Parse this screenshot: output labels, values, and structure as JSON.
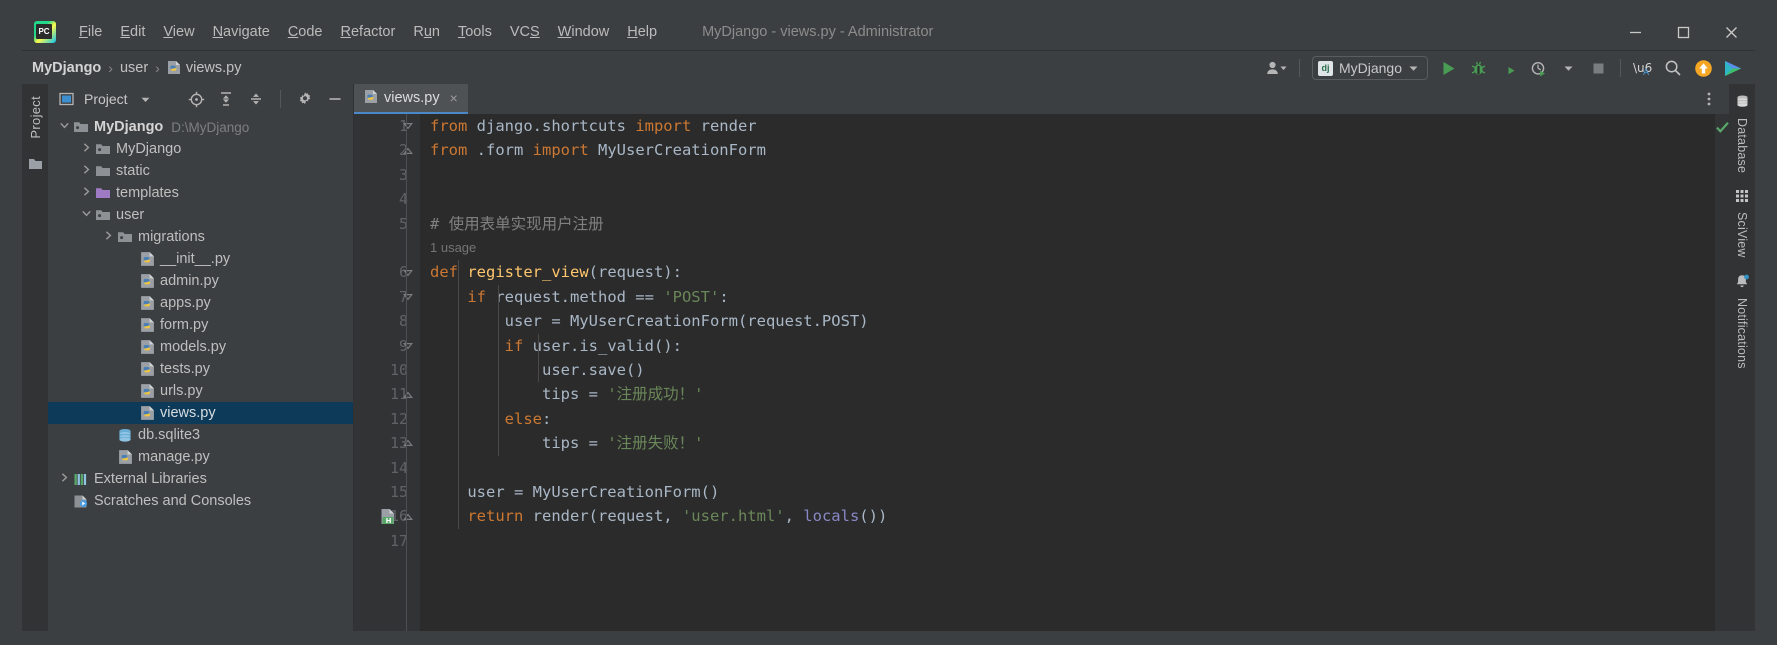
{
  "window": {
    "title": "MyDjango - views.py - Administrator",
    "minimize_label": "minimize-window",
    "maximize_label": "maximize-window",
    "close_label": "close-window"
  },
  "menu": [
    {
      "label": "File",
      "mnemonic": "F"
    },
    {
      "label": "Edit",
      "mnemonic": "E"
    },
    {
      "label": "View",
      "mnemonic": "V"
    },
    {
      "label": "Navigate",
      "mnemonic": "N"
    },
    {
      "label": "Code",
      "mnemonic": "C"
    },
    {
      "label": "Refactor",
      "mnemonic": "R"
    },
    {
      "label": "Run",
      "mnemonic": "u"
    },
    {
      "label": "Tools",
      "mnemonic": "T"
    },
    {
      "label": "VCS",
      "mnemonic": "S"
    },
    {
      "label": "Window",
      "mnemonic": "W"
    },
    {
      "label": "Help",
      "mnemonic": "H"
    }
  ],
  "breadcrumb": {
    "items": [
      "MyDjango",
      "user",
      "views.py"
    ],
    "separator": "›"
  },
  "toolbar": {
    "account_icon": "user-account-icon",
    "run_config": {
      "label": "MyDjango",
      "icon_text": "dj"
    },
    "run_icon": "run-icon",
    "debug_icon": "debug-icon",
    "run_coverage_icon": "run-with-coverage-icon",
    "profile_icon": "profile-icon",
    "stop_icon": "stop-icon",
    "translate_icon": "translate-icon",
    "search_icon": "search-everywhere-icon",
    "update_icon": "update-project-icon",
    "plugin_icon": "plugin-icon"
  },
  "project_panel": {
    "title": "Project",
    "stripe_label": "Project",
    "select_opened_file_icon": "select-opened-file-icon",
    "expand_all_icon": "expand-all-icon",
    "collapse_all_icon": "collapse-all-icon",
    "settings_icon": "gear-icon",
    "hide_icon": "hide-panel-icon",
    "tree": [
      {
        "label": "MyDjango",
        "detail": "D:\\MyDjango",
        "indent": 0,
        "arrow": "down",
        "icon": "project-folder",
        "bold": true,
        "selected": false
      },
      {
        "label": "MyDjango",
        "detail": "",
        "indent": 1,
        "arrow": "right",
        "icon": "module-folder",
        "bold": false,
        "selected": false
      },
      {
        "label": "static",
        "detail": "",
        "indent": 1,
        "arrow": "right",
        "icon": "folder",
        "bold": false,
        "selected": false
      },
      {
        "label": "templates",
        "detail": "",
        "indent": 1,
        "arrow": "right",
        "icon": "templates-folder",
        "bold": false,
        "selected": false
      },
      {
        "label": "user",
        "detail": "",
        "indent": 1,
        "arrow": "down",
        "icon": "module-folder",
        "bold": false,
        "selected": false
      },
      {
        "label": "migrations",
        "detail": "",
        "indent": 2,
        "arrow": "right",
        "icon": "module-folder",
        "bold": false,
        "selected": false
      },
      {
        "label": "__init__.py",
        "detail": "",
        "indent": 3,
        "arrow": "none",
        "icon": "python-file",
        "bold": false,
        "selected": false
      },
      {
        "label": "admin.py",
        "detail": "",
        "indent": 3,
        "arrow": "none",
        "icon": "python-file",
        "bold": false,
        "selected": false
      },
      {
        "label": "apps.py",
        "detail": "",
        "indent": 3,
        "arrow": "none",
        "icon": "python-file",
        "bold": false,
        "selected": false
      },
      {
        "label": "form.py",
        "detail": "",
        "indent": 3,
        "arrow": "none",
        "icon": "python-file",
        "bold": false,
        "selected": false
      },
      {
        "label": "models.py",
        "detail": "",
        "indent": 3,
        "arrow": "none",
        "icon": "python-file",
        "bold": false,
        "selected": false
      },
      {
        "label": "tests.py",
        "detail": "",
        "indent": 3,
        "arrow": "none",
        "icon": "python-file",
        "bold": false,
        "selected": false
      },
      {
        "label": "urls.py",
        "detail": "",
        "indent": 3,
        "arrow": "none",
        "icon": "python-file",
        "bold": false,
        "selected": false
      },
      {
        "label": "views.py",
        "detail": "",
        "indent": 3,
        "arrow": "none",
        "icon": "python-file",
        "bold": false,
        "selected": true
      },
      {
        "label": "db.sqlite3",
        "detail": "",
        "indent": 2,
        "arrow": "none",
        "icon": "database-file",
        "bold": false,
        "selected": false
      },
      {
        "label": "manage.py",
        "detail": "",
        "indent": 2,
        "arrow": "none",
        "icon": "python-file",
        "bold": false,
        "selected": false
      },
      {
        "label": "External Libraries",
        "detail": "",
        "indent": 0,
        "arrow": "right",
        "icon": "libraries",
        "bold": false,
        "selected": false
      },
      {
        "label": "Scratches and Consoles",
        "detail": "",
        "indent": 0,
        "arrow": "none",
        "icon": "scratches",
        "bold": false,
        "selected": false
      }
    ]
  },
  "editor": {
    "tab": {
      "label": "views.py",
      "icon": "python-file",
      "close": "×"
    },
    "options_icon": "editor-options-icon",
    "inspection_status": "ok-checkmark",
    "first_line": 1,
    "last_line": 17,
    "lines": [
      {
        "n": 1,
        "fold": "down",
        "tokens": [
          [
            "kw",
            "from"
          ],
          [
            "txt",
            " django.shortcuts "
          ],
          [
            "kw",
            "import"
          ],
          [
            "txt",
            " render"
          ]
        ]
      },
      {
        "n": 2,
        "fold": "end",
        "tokens": [
          [
            "kw",
            "from"
          ],
          [
            "txt",
            " .form "
          ],
          [
            "kw",
            "import"
          ],
          [
            "txt",
            " MyUserCreationForm"
          ]
        ]
      },
      {
        "n": 3,
        "fold": "none",
        "tokens": []
      },
      {
        "n": 4,
        "fold": "none",
        "tokens": []
      },
      {
        "n": 5,
        "fold": "none",
        "tokens": [
          [
            "cmt",
            "# 使用表单实现用户注册"
          ]
        ]
      },
      {
        "n": 6,
        "fold": "down",
        "hint": "1 usage",
        "tokens": [
          [
            "kw",
            "def"
          ],
          [
            "fn",
            " register_view"
          ],
          [
            "txt",
            "(request):"
          ]
        ]
      },
      {
        "n": 7,
        "fold": "down",
        "tokens": [
          [
            "txt",
            "    "
          ],
          [
            "kw",
            "if"
          ],
          [
            "txt",
            " request.method == "
          ],
          [
            "str",
            "'POST'"
          ],
          [
            "txt",
            ":"
          ]
        ]
      },
      {
        "n": 8,
        "fold": "none",
        "tokens": [
          [
            "txt",
            "        user = MyUserCreationForm(request.POST)"
          ]
        ]
      },
      {
        "n": 9,
        "fold": "down",
        "tokens": [
          [
            "txt",
            "        "
          ],
          [
            "kw",
            "if"
          ],
          [
            "txt",
            " user.is_valid():"
          ]
        ]
      },
      {
        "n": 10,
        "fold": "none",
        "tokens": [
          [
            "txt",
            "            user.save()"
          ]
        ]
      },
      {
        "n": 11,
        "fold": "end",
        "tokens": [
          [
            "txt",
            "            tips = "
          ],
          [
            "str",
            "'注册成功！'"
          ]
        ]
      },
      {
        "n": 12,
        "fold": "none",
        "tokens": [
          [
            "txt",
            "        "
          ],
          [
            "kw",
            "else"
          ],
          [
            "txt",
            ":"
          ]
        ]
      },
      {
        "n": 13,
        "fold": "end",
        "tokens": [
          [
            "txt",
            "            tips = "
          ],
          [
            "str",
            "'注册失败！'"
          ]
        ]
      },
      {
        "n": 14,
        "fold": "none",
        "tokens": []
      },
      {
        "n": 15,
        "fold": "none",
        "tokens": [
          [
            "txt",
            "    user = MyUserCreationForm()"
          ]
        ]
      },
      {
        "n": 16,
        "fold": "end",
        "gutter_icon": "html-file-marker",
        "tokens": [
          [
            "kw",
            "    return"
          ],
          [
            "txt",
            " render(request, "
          ],
          [
            "str",
            "'user.html'"
          ],
          [
            "txt",
            ", "
          ],
          [
            "bi",
            "locals"
          ],
          [
            "txt",
            "())"
          ]
        ]
      },
      {
        "n": 17,
        "fold": "none",
        "tokens": []
      }
    ]
  },
  "right_stripe": {
    "tools": [
      {
        "label": "Database",
        "icon": "database-icon",
        "badge": false
      },
      {
        "label": "SciView",
        "icon": "sciview-icon",
        "badge": false
      },
      {
        "label": "Notifications",
        "icon": "bell-icon",
        "badge": true
      }
    ]
  },
  "colors": {
    "accent_blue": "#4a88c7",
    "selection_blue": "#0d3a58",
    "editor_bg": "#2b2b2b",
    "panel_bg": "#3c3f41",
    "gutter_bg": "#313335",
    "keyword": "#cc7832",
    "string": "#6a8759",
    "function": "#ffc66d",
    "text": "#a9b7c6",
    "comment": "#808080",
    "builtin": "#8888c6",
    "run_green": "#499c54",
    "update_orange": "#f5a623"
  }
}
